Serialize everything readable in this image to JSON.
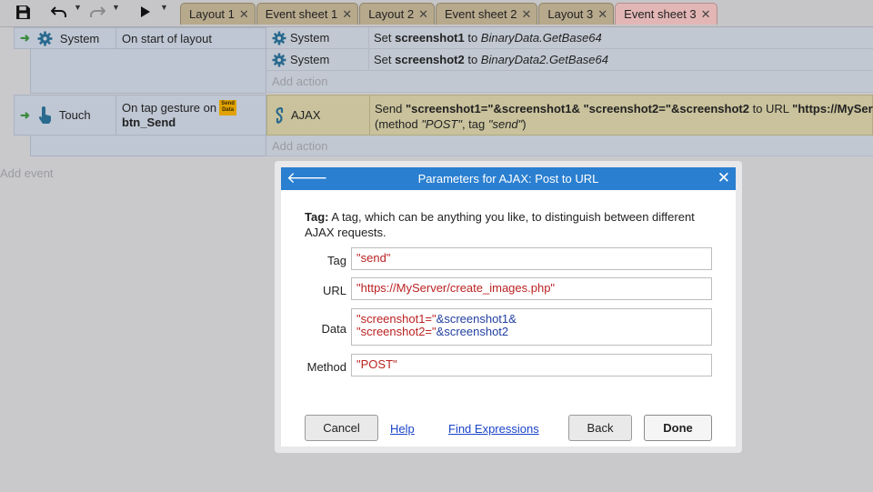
{
  "toolbar": {
    "tabs": [
      {
        "label": "Layout 1",
        "active": false
      },
      {
        "label": "Event sheet 1",
        "active": false
      },
      {
        "label": "Layout 2",
        "active": false
      },
      {
        "label": "Event sheet 2",
        "active": false
      },
      {
        "label": "Layout 3",
        "active": false
      },
      {
        "label": "Event sheet 3",
        "active": true
      }
    ],
    "close_glyph": "✕",
    "icons": [
      "save-icon",
      "undo-icon",
      "redo-icon",
      "play-icon"
    ]
  },
  "events": [
    {
      "condition_object": "System",
      "condition_text": "On start of layout",
      "actions": [
        {
          "object": "System",
          "pre": "Set ",
          "bold": "screenshot1",
          "mid": " to ",
          "italic": "BinaryData.GetBase64"
        },
        {
          "object": "System",
          "pre": "Set ",
          "bold": "screenshot2",
          "mid": " to ",
          "italic": "BinaryData2.GetBase64"
        }
      ],
      "add_action": "Add action"
    },
    {
      "condition_object": "Touch",
      "condition_text": "On tap gesture on",
      "condition_target": "btn_Send",
      "badge": "Send Data",
      "action": {
        "object": "AJAX",
        "line1_pre": "Send ",
        "line1_bold": "\"screenshot1=\"&screenshot1& \"screenshot2=\"&screenshot2",
        "line1_mid": "  to URL ",
        "line1_bold2": "\"https://MyServ",
        "line2_pre": "(method ",
        "line2_method": "\"POST\"",
        "line2_mid": ", tag ",
        "line2_tag": "\"send\"",
        "line2_end": ")"
      },
      "add_action": "Add action"
    }
  ],
  "add_event": "Add event",
  "dialog": {
    "title": "Parameters for AJAX: Post to URL",
    "desc_label": "Tag:",
    "desc_text": " A tag, which can be anything you like, to distinguish between different AJAX requests.",
    "fields": {
      "tag_label": "Tag",
      "tag_value": "\"send\"",
      "url_label": "URL",
      "url_value": "\"https://MyServer/create_images.php\"",
      "data_label": "Data",
      "data_line1_str": "\"screenshot1=\"",
      "data_line1_var": "&screenshot1&",
      "data_line2_str": "\"screenshot2=\"",
      "data_line2_var": "&screenshot2",
      "method_label": "Method",
      "method_value": "\"POST\""
    },
    "buttons": {
      "cancel": "Cancel",
      "help": "Help",
      "find_expressions": "Find Expressions",
      "back": "Back",
      "done": "Done"
    }
  }
}
